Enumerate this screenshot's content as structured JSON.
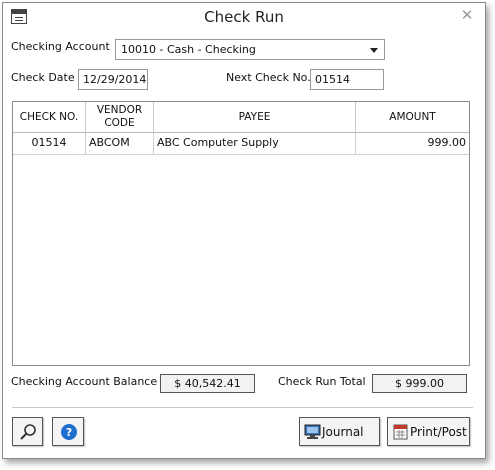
{
  "window": {
    "title": "Check Run"
  },
  "form": {
    "checking_account_label": "Checking Account",
    "checking_account_value": "10010 - Cash - Checking",
    "check_date_label": "Check Date",
    "check_date_value": "12/29/2014",
    "next_check_label": "Next Check No.",
    "next_check_value": "01514"
  },
  "grid": {
    "columns": [
      "CHECK NO.",
      "VENDOR\nCODE",
      "PAYEE",
      "AMOUNT"
    ],
    "rows": [
      {
        "check_no": "01514",
        "vendor_code": "ABCOM",
        "payee": "ABC Computer Supply",
        "amount": "999.00"
      }
    ]
  },
  "summary": {
    "balance_label": "Checking Account Balance",
    "balance_value": "$ 40,542.41",
    "total_label": "Check Run Total",
    "total_value": "$ 999.00"
  },
  "footer": {
    "journal_label": "Journal",
    "printpost_label": "Print/Post"
  },
  "icons": {
    "app": "window-app-icon",
    "close": "close-icon",
    "search": "magnifier-icon",
    "help": "help-icon",
    "journal": "monitor-icon",
    "printpost": "calendar-icon"
  },
  "colors": {
    "help_blue": "#1f6fd0",
    "accent_red": "#c0392b"
  }
}
